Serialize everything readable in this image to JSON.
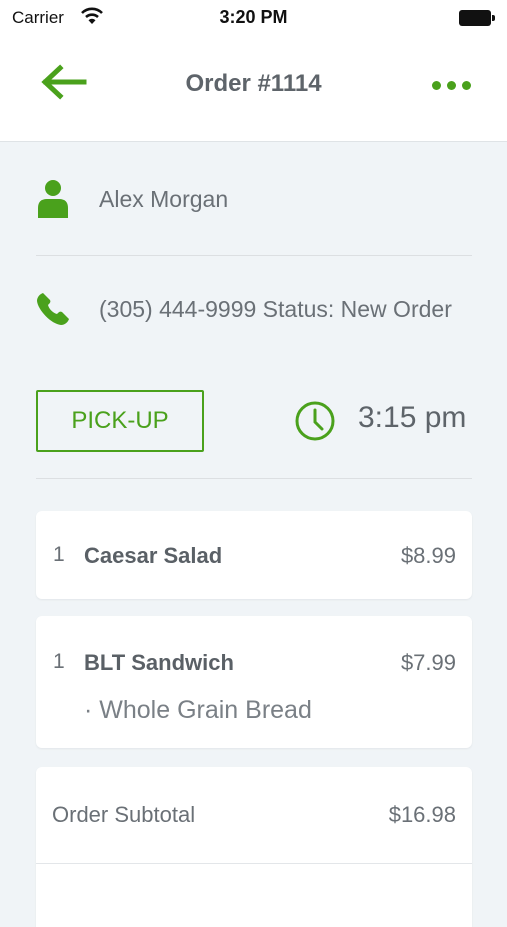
{
  "status_bar": {
    "carrier": "Carrier",
    "time": "3:20 PM"
  },
  "nav": {
    "title": "Order #1114"
  },
  "customer": {
    "name": "Alex Morgan",
    "phone_status": "(305) 444-9999 Status: New Order"
  },
  "order_type": {
    "label": "PICK-UP",
    "time": "3:15 pm"
  },
  "items": [
    {
      "qty": "1",
      "name": "Caesar Salad",
      "price": "$8.99"
    },
    {
      "qty": "1",
      "name": "BLT Sandwich",
      "price": "$7.99",
      "modifier": "· Whole Grain Bread"
    }
  ],
  "summary": {
    "subtotal_label": "Order Subtotal",
    "subtotal_value": "$16.98"
  },
  "colors": {
    "accent": "#4aa11c",
    "background": "#f0f4f7",
    "text": "#5e646a"
  }
}
